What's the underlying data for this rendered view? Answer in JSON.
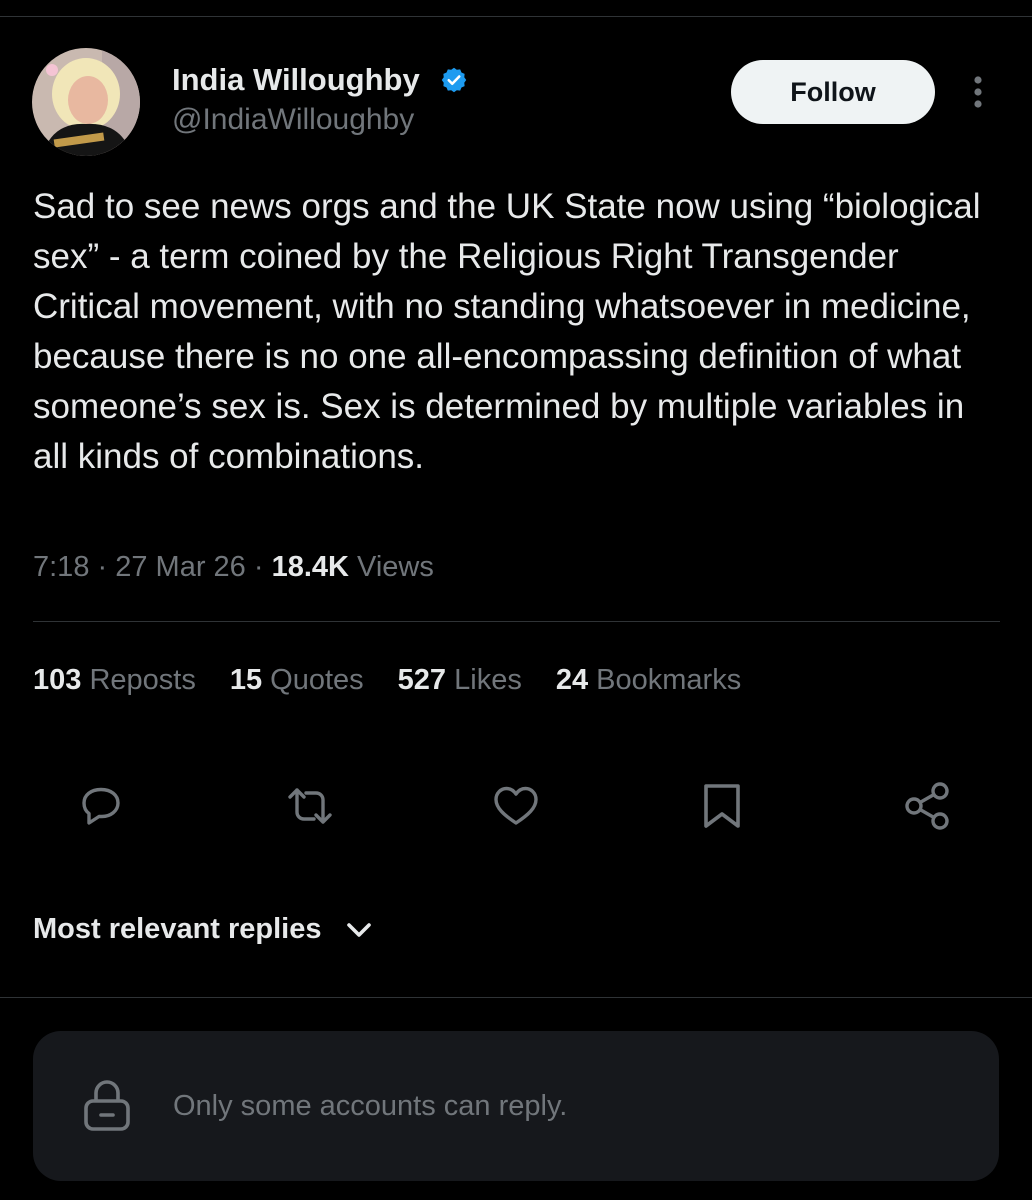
{
  "author": {
    "name": "India Willoughby",
    "handle": "@IndiaWilloughby",
    "avatar_icon": "profile-photo",
    "verified_icon": "verified-badge-icon",
    "verified_color": "#1d9bf0"
  },
  "follow_label": "Follow",
  "tweet": {
    "text": "Sad to see news orgs and the UK State now using “biological sex” - a term coined by the Religious Right Transgender Critical movement, with no standing whatsoever in medicine, because there is no one all-encompassing definition of what someone’s sex is. Sex is determined by multiple variables in all kinds of combinations.",
    "time": "7:18",
    "date": "27 Mar 26",
    "views_count": "18.4K",
    "views_label": "Views"
  },
  "stats": [
    {
      "count": "103",
      "label": "Reposts"
    },
    {
      "count": "15",
      "label": "Quotes"
    },
    {
      "count": "527",
      "label": "Likes"
    },
    {
      "count": "24",
      "label": "Bookmarks"
    }
  ],
  "actions": [
    "reply-icon",
    "repost-icon",
    "like-icon",
    "bookmark-icon",
    "share-icon"
  ],
  "replies_sort": {
    "label": "Most relevant replies",
    "icon": "chevron-down-icon"
  },
  "reply_restriction": {
    "text": "Only some accounts can reply.",
    "icon": "lock-icon"
  },
  "colors": {
    "background": "#000000",
    "text": "#e7e9ea",
    "muted": "#71767b",
    "accent": "#1d9bf0"
  }
}
